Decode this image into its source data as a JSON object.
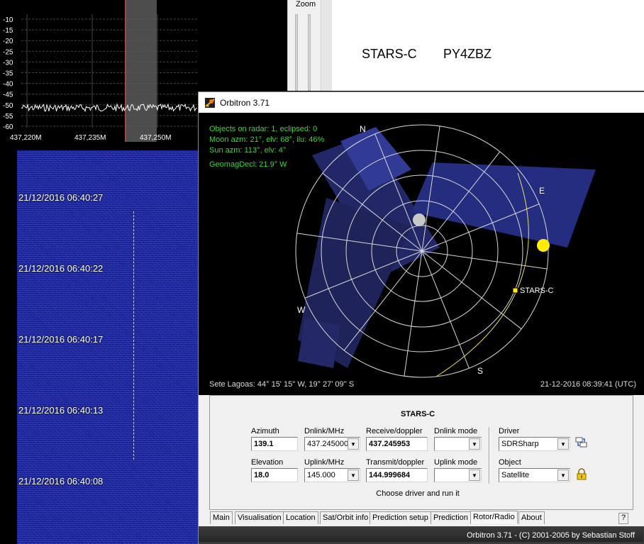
{
  "spectrum": {
    "y_labels": [
      "-10",
      "-15",
      "-20",
      "-25",
      "-30",
      "-35",
      "-40",
      "-45",
      "-50",
      "-55",
      "-60"
    ],
    "x_labels": [
      "437,220M",
      "437,235M",
      "437,250M"
    ],
    "trace_color": "#ffffff",
    "selection_color": "#ff3b3b"
  },
  "zoom": {
    "label": "Zoom"
  },
  "title_area": {
    "satellite": "STARS-C",
    "callsign": "PY4ZBZ"
  },
  "waterfall": {
    "timestamps": [
      "21/12/2016 06:40:27",
      "21/12/2016 06:40:22",
      "21/12/2016 06:40:17",
      "21/12/2016 06:40:13",
      "21/12/2016 06:40:08"
    ],
    "color": "#1b25a6"
  },
  "orbitron": {
    "title": "Orbitron 3.71",
    "radar": {
      "objects_info": "Objects on radar: 1, eclipsed: 0",
      "moon_info": "Moon azm: 21°, elv: 68°, ilu: 46%",
      "sun_info": "Sun azm: 113°, elv: 4°",
      "geomag": "GeomagDecl: 21.9° W",
      "north": "N",
      "east": "E",
      "south": "S",
      "west": "W",
      "satellite_label": "STARS-C",
      "location": "Sete Lagoas: 44° 15' 15'' W, 19° 27' 09'' S",
      "datetime": "21-12-2016 08:39:41 (UTC)",
      "info_color": "#41d241"
    },
    "panel": {
      "title": "STARS-C",
      "azimuth_label": "Azimuth",
      "azimuth_value": "139.1",
      "elevation_label": "Elevation",
      "elevation_value": "18.0",
      "dnlink_label": "Dnlink/MHz",
      "dnlink_value": "437.245000",
      "uplink_label": "Uplink/MHz",
      "uplink_value": "145.000",
      "receive_label": "Receive/doppler",
      "receive_value": "437.245953",
      "transmit_label": "Transmit/doppler",
      "transmit_value": "144.999684",
      "dnlink_mode_label": "Dnlink mode",
      "dnlink_mode_value": "",
      "uplink_mode_label": "Uplink mode",
      "uplink_mode_value": "",
      "driver_label": "Driver",
      "driver_value": "SDRSharp",
      "object_label": "Object",
      "object_value": "Satellite",
      "hint": "Choose driver and run it"
    },
    "tabs": [
      "Main",
      "Visualisation",
      "Location",
      "Sat/Orbit info",
      "Prediction setup",
      "Prediction",
      "Rotor/Radio",
      "About"
    ],
    "active_tab": "Rotor/Radio",
    "help_tab": "?",
    "status": "Orbitron 3.71 - (C) 2001-2005 by Sebastian Stoff"
  }
}
